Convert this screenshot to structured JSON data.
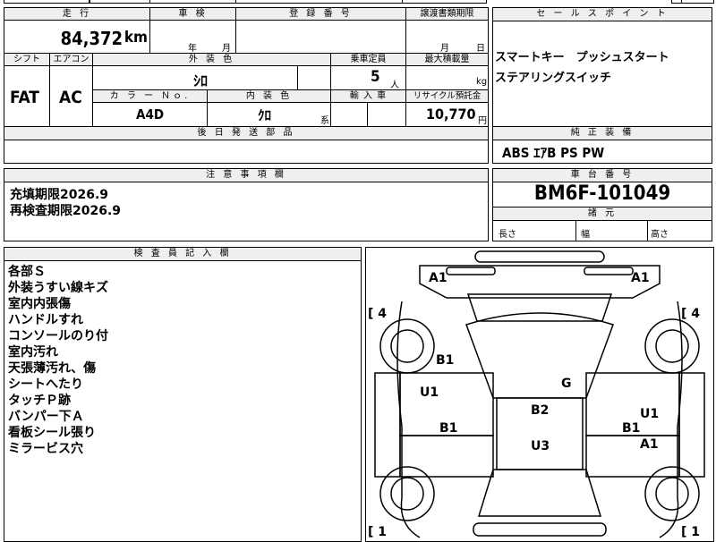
{
  "top_row": {
    "left_fragment": "",
    "mid_fragment": ""
  },
  "mileage": {
    "header": "走 行",
    "value": "84,372",
    "unit": "km"
  },
  "shaken": {
    "header": "車 検",
    "year_label": "年",
    "month_label": "月"
  },
  "registration": {
    "header": "登 録 番 号"
  },
  "transfer": {
    "header": "譲渡書類期限",
    "month_label": "月",
    "day_label": "日"
  },
  "shift": {
    "header": "シフト",
    "value": "FAT"
  },
  "aircon": {
    "header": "エアコン",
    "value": "AC"
  },
  "exterior_color": {
    "header": "外 装 色",
    "value": "ｼﾛ"
  },
  "capacity": {
    "header": "乗車定員",
    "value": "5",
    "unit": "人"
  },
  "max_load": {
    "header": "最大積載量",
    "unit": "kg"
  },
  "color_no": {
    "header": "カ ラ ー Ｎｏ.",
    "value": "A4D"
  },
  "interior_color": {
    "header": "内 装 色",
    "value": "ｸﾛ",
    "suffix": "系"
  },
  "import": {
    "header": "輸 入 車"
  },
  "recycle": {
    "header": "リサイクル預託金",
    "value": "10,770",
    "unit": "円"
  },
  "later_parts": {
    "header": "後 日 発 送 部 品"
  },
  "sales_point": {
    "header": "セ ー ル ス ポ イ ン ト",
    "lines": [
      "スマートキー　プッシュスタート",
      "ステアリングスイッチ"
    ]
  },
  "genuine_equipment": {
    "header": "純 正 装 備",
    "value": "ABS ｴｱB PS PW"
  },
  "caution": {
    "header": "注 意 事 項 欄",
    "lines": [
      "充填期限2026.9",
      "再検査期限2026.9"
    ]
  },
  "chassis": {
    "header": "車 台 番 号",
    "value": "BM6F-101049"
  },
  "specs": {
    "header": "諸 元",
    "length": "長さ",
    "width": "幅",
    "height": "高さ"
  },
  "inspector": {
    "header": "検 査 員 記 入 欄",
    "lines": [
      "各部Ｓ",
      "外装うすい線キズ",
      "室内内張傷",
      "ハンドルすれ",
      "コンソールのり付",
      "室内汚れ",
      "天張薄汚れ、傷",
      "シートへたり",
      "タッチＰ跡",
      "バンパー下Ａ",
      "看板シール張り",
      "ミラービス穴"
    ]
  },
  "diagram": {
    "marks": {
      "a1_left": "A1",
      "a1_right": "A1",
      "tire_fl": "[ 4",
      "tire_fr": "[ 4",
      "tire_rl": "[ 1",
      "tire_rr": "[ 1",
      "b1_hood_left": "B1",
      "g_window": "G",
      "u1_left": "U1",
      "b1_left": "B1",
      "b2_roof": "B2",
      "u3_roof": "U3",
      "u1_right": "U1",
      "b1_right": "B1",
      "a1_right_door": "A1"
    }
  }
}
